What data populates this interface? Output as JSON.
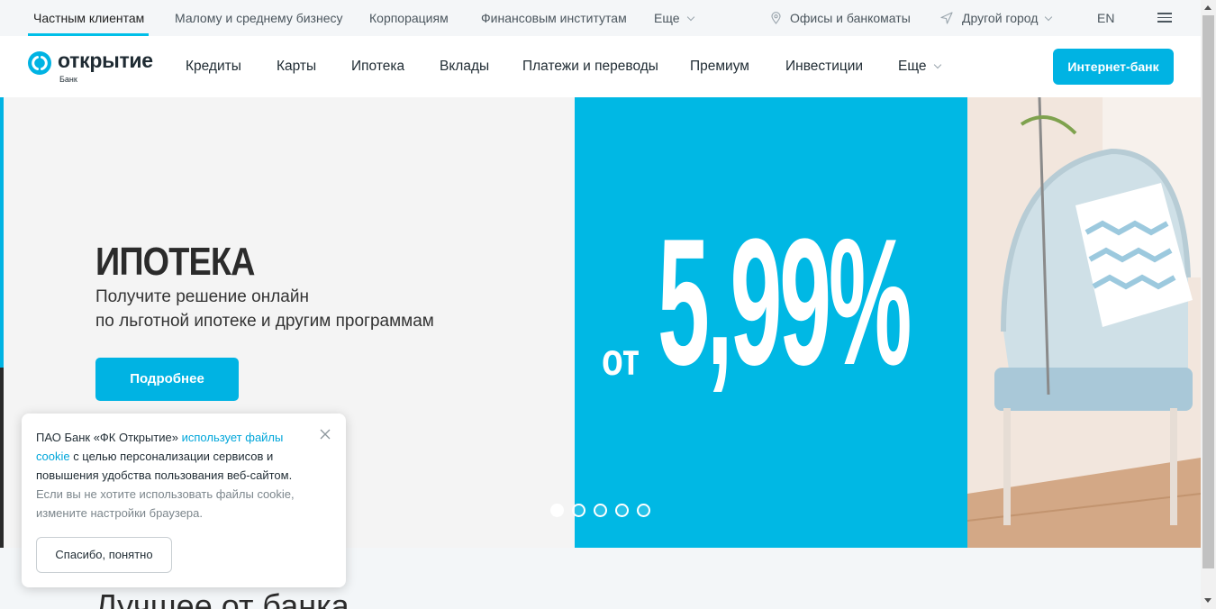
{
  "topbar": {
    "segments": [
      {
        "label": "Частным клиентам"
      },
      {
        "label": "Малому и среднему бизнесу"
      },
      {
        "label": "Корпорациям"
      },
      {
        "label": "Финансовым институтам"
      },
      {
        "label": "Еще"
      }
    ],
    "offices_label": "Офисы и банкоматы",
    "city_label": "Другой город",
    "lang_label": "EN"
  },
  "logo": {
    "word": "открытие",
    "sub": "Банк"
  },
  "nav": {
    "items": [
      "Кредиты",
      "Карты",
      "Ипотека",
      "Вклады",
      "Платежи и переводы",
      "Премиум",
      "Инвестиции",
      "Еще"
    ],
    "internet_bank_label": "Интернет-банк"
  },
  "hero": {
    "title": "ИПОТЕКА",
    "subtitle_line1": "Получите решение онлайн",
    "subtitle_line2": "по льготной ипотеке и другим программам",
    "button_label": "Подробнее",
    "promo_prefix": "от",
    "promo_rate": "5,99%",
    "slides_total": 5,
    "slide_active": 1
  },
  "section": {
    "title": "Лучшее от банка"
  },
  "cookie": {
    "text_1": "ПАО Банк «ФК Открытие» ",
    "link": "использует файлы cookie",
    "text_2": " с целью персонализации сервисов и повышения удобства пользования веб-сайтом.",
    "text_muted": "Если вы не хотите использовать файлы cookie, измените настройки браузера.",
    "button_label": "Спасибо, понятно"
  },
  "colors": {
    "accent": "#00b3e3",
    "promo_bg": "#00b8e4",
    "text": "#1f2b33"
  }
}
